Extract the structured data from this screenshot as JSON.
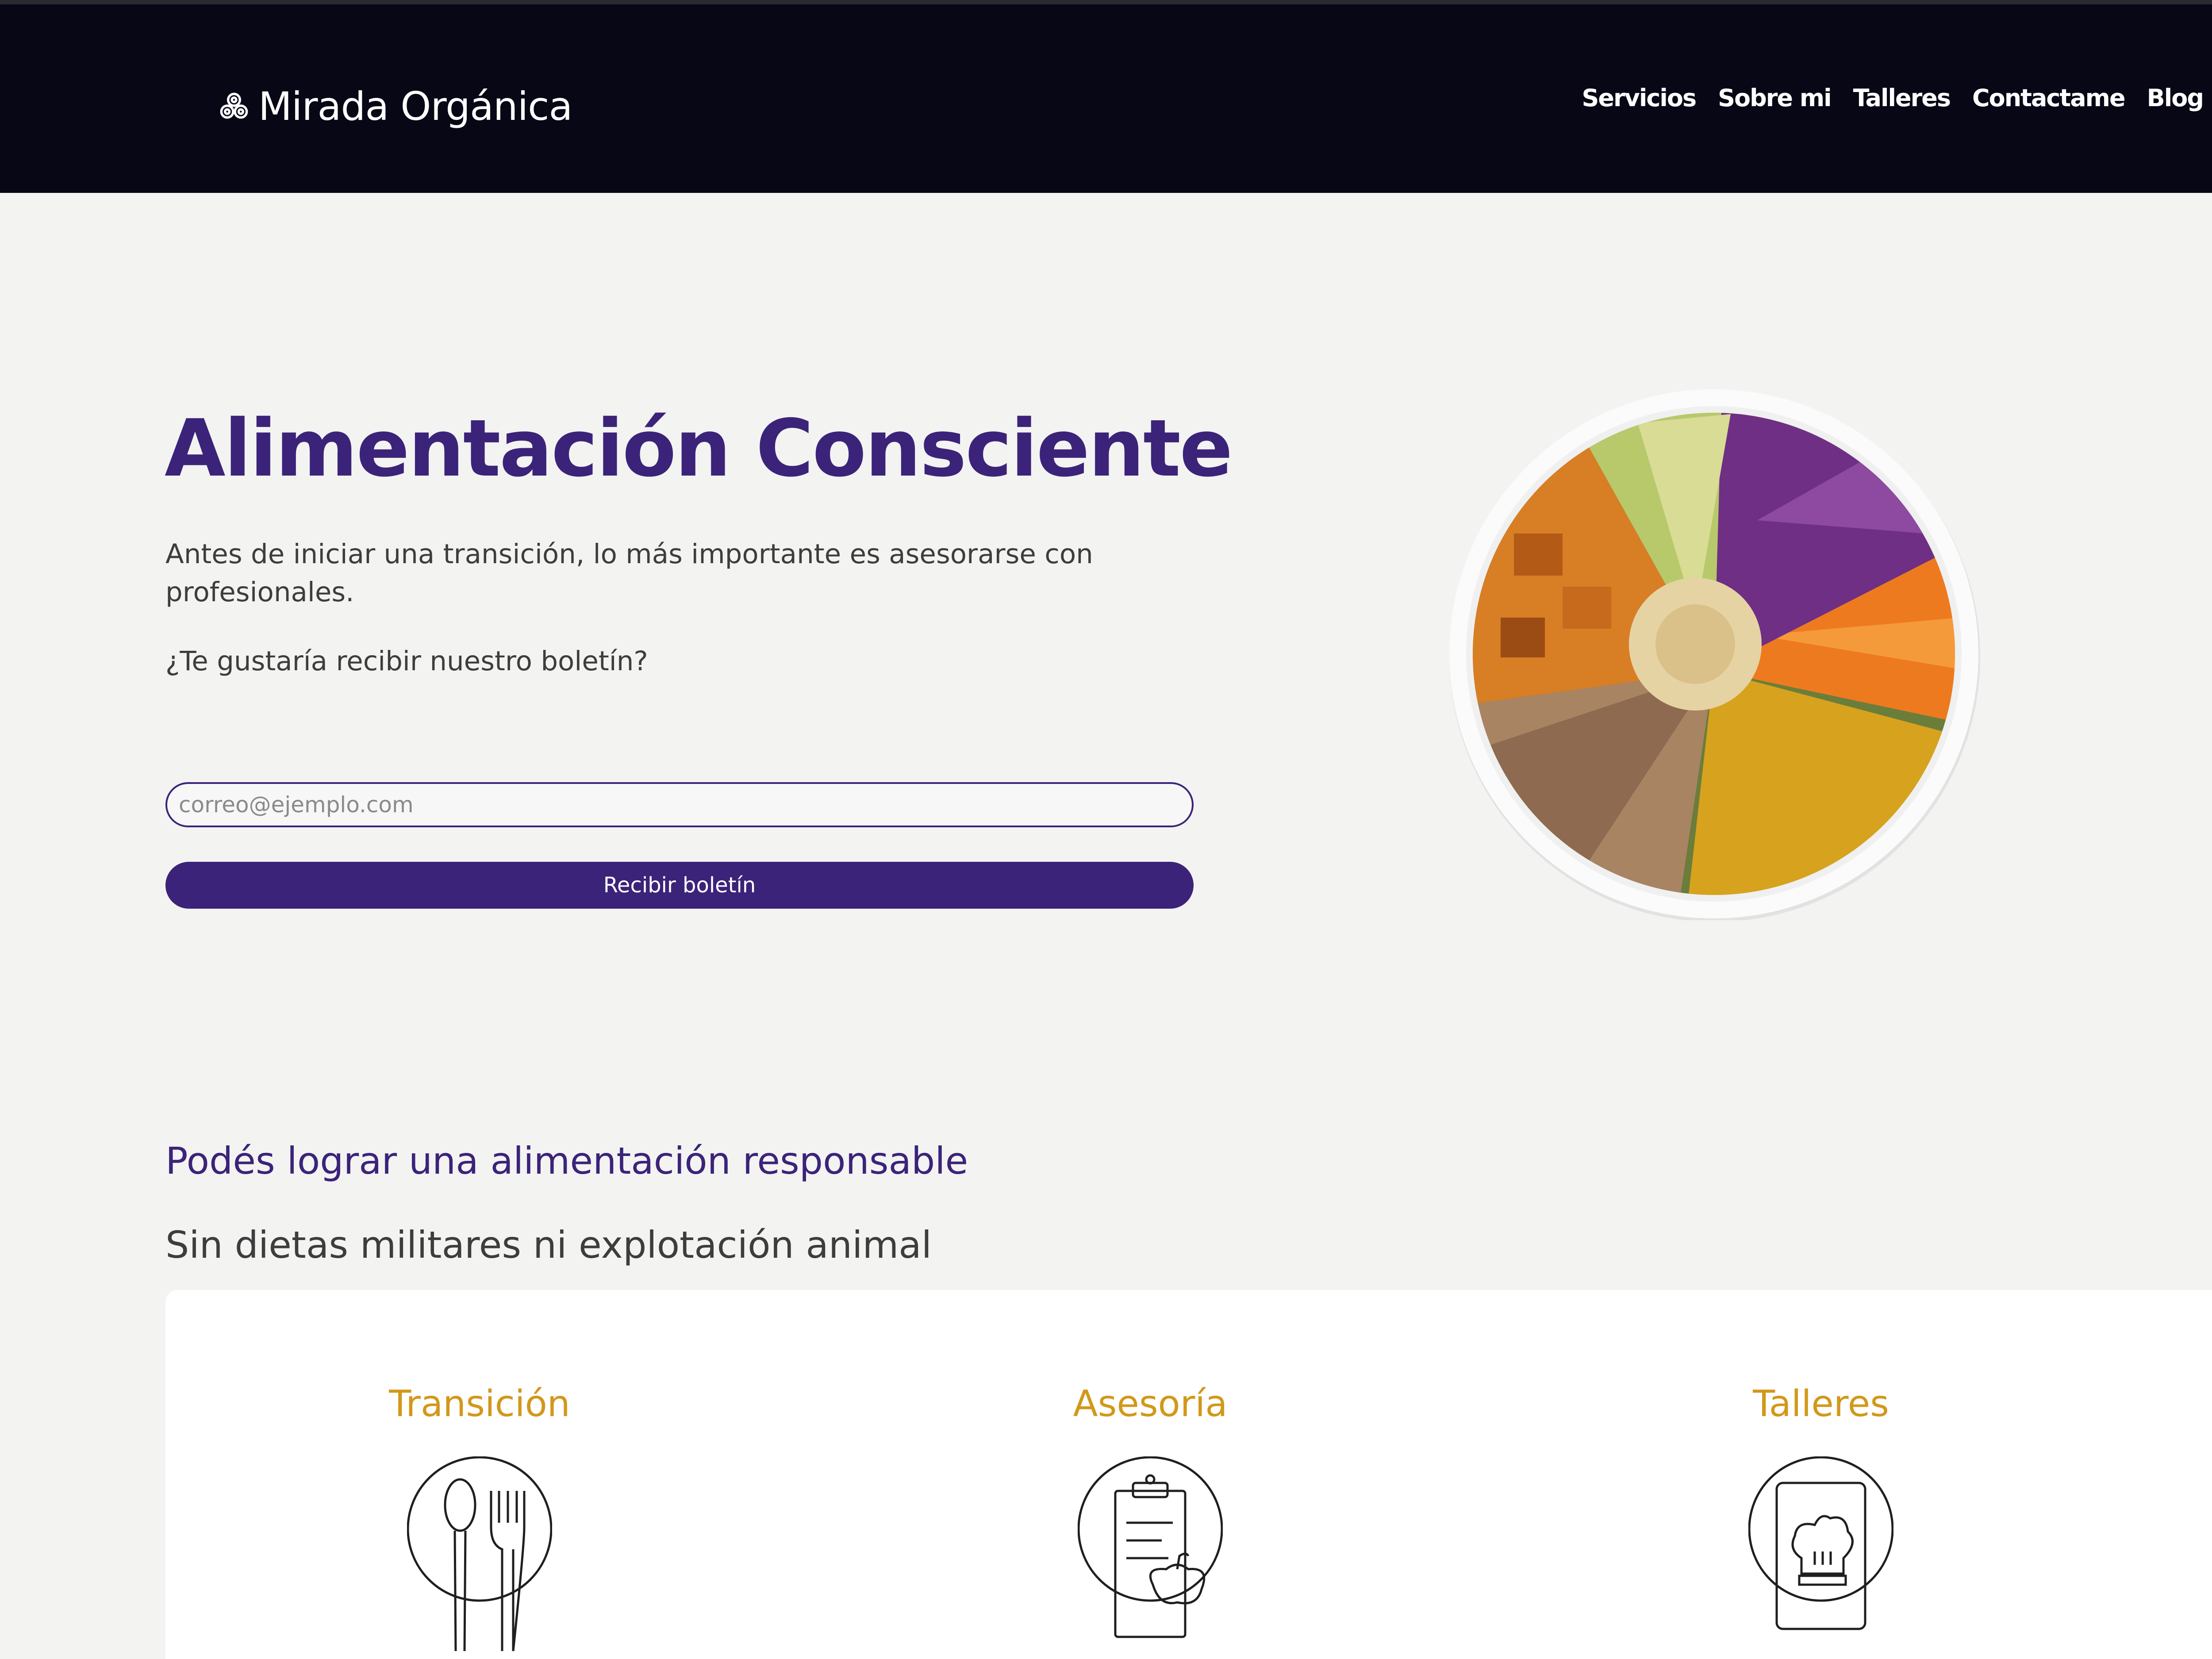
{
  "header": {
    "brand": "Mirada Orgánica",
    "brand_icon": "triskelion-icon",
    "nav": [
      "Servicios",
      "Sobre mi",
      "Talleres",
      "Contactame",
      "Blog"
    ]
  },
  "hero": {
    "title": "Alimentación Consciente",
    "description": "Antes de iniciar una transición, lo más importante es asesorarse con profesionales.",
    "question": "¿Te gustaría recibir nuestro boletín?",
    "email_placeholder": "correo@ejemplo.com",
    "button_label": "Recibir boletín",
    "image": "salad-bowl-image"
  },
  "section": {
    "title": "Podés lograr una alimentación responsable",
    "subtitle": "Sin dietas militares ni explotación animal"
  },
  "services": [
    {
      "title": "Transición",
      "icon": "spoon-fork-icon"
    },
    {
      "title": "Asesoría",
      "icon": "clipboard-apple-icon"
    },
    {
      "title": "Talleres",
      "icon": "chef-hat-icon"
    }
  ],
  "colors": {
    "primary": "#3b2379",
    "accent": "#d2981b",
    "navbar": "#080716",
    "background": "#f3f3f2"
  }
}
